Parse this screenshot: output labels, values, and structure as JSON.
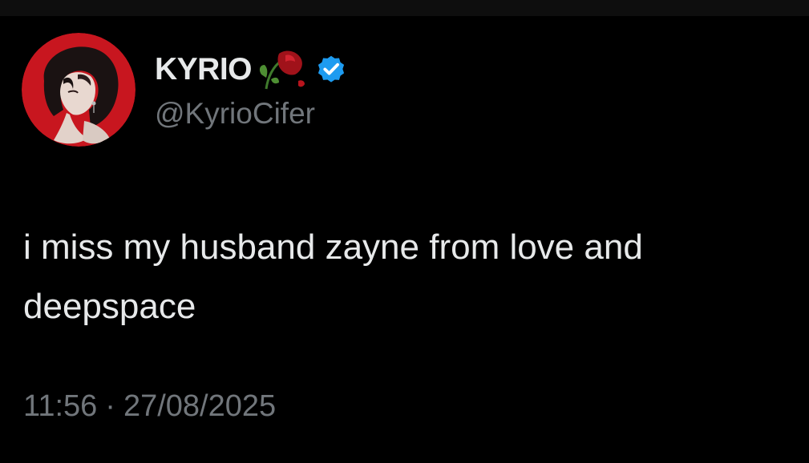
{
  "tweet": {
    "author": {
      "display_name": "KYRIO",
      "name_emoji": "wilted-rose-icon",
      "verified": true,
      "handle": "@KyrioCifer",
      "avatar": "anime-portrait-avatar"
    },
    "text": "i miss my husband zayne from love and deepspace",
    "time": "11:56",
    "separator": "·",
    "date": "27/08/2025"
  },
  "colors": {
    "background": "#000000",
    "primary_text": "#e7e9ea",
    "secondary_text": "#71767b",
    "verified_blue": "#1d9bf0",
    "avatar_ring": "#c8161f"
  }
}
